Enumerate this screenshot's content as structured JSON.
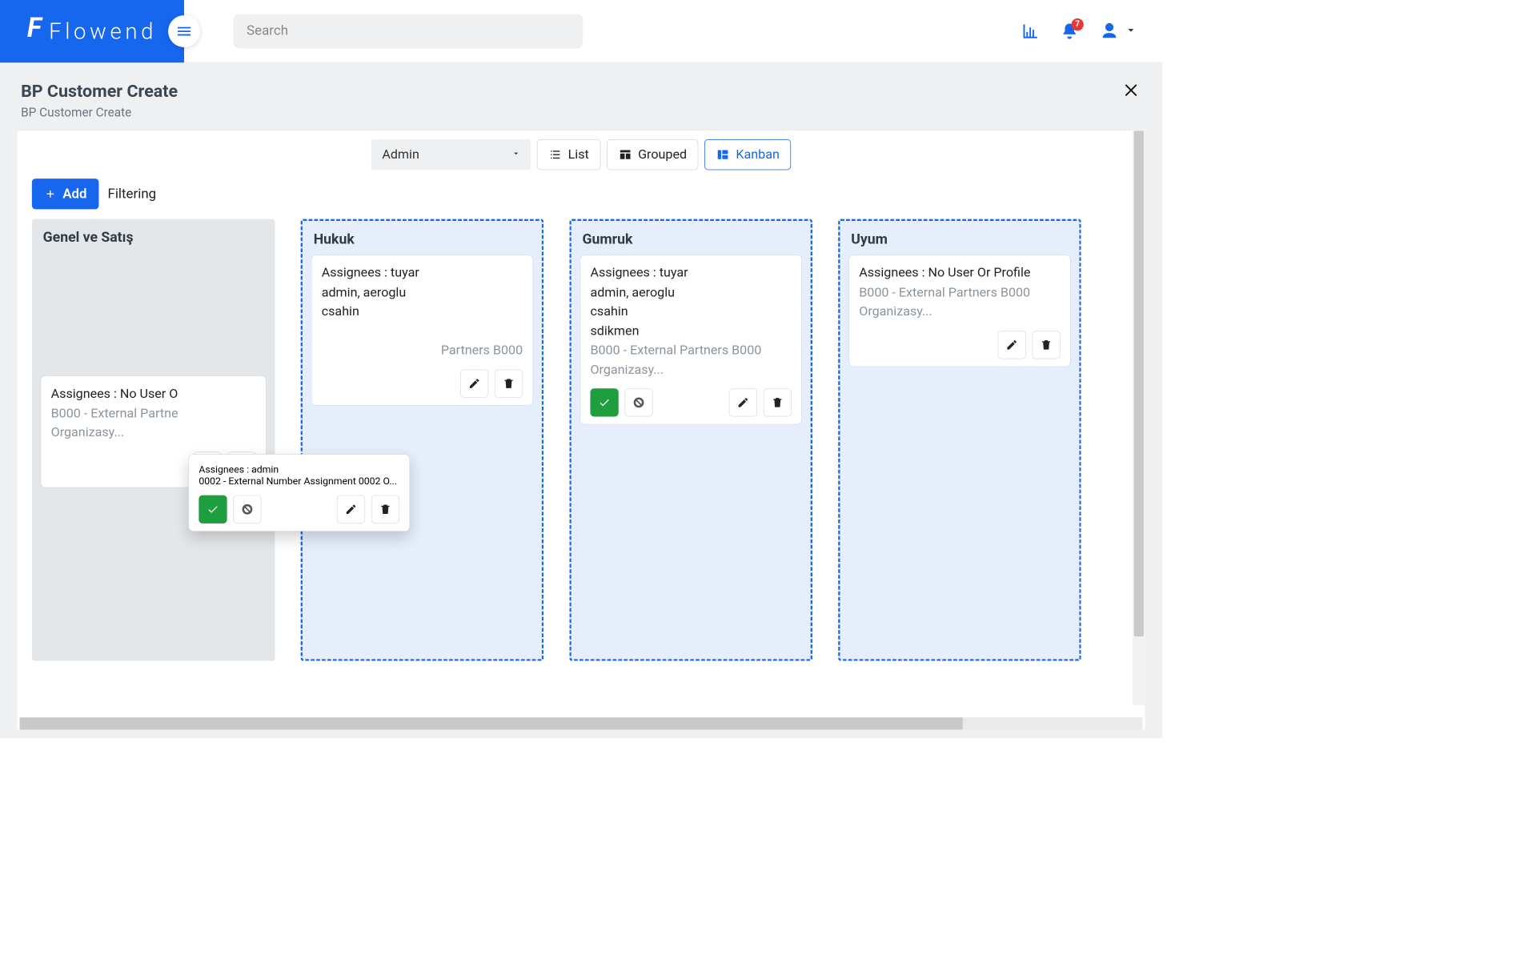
{
  "brand": {
    "name": "Flowend"
  },
  "search": {
    "placeholder": "Search"
  },
  "notifications": {
    "count": 7
  },
  "page": {
    "title": "BP Customer Create",
    "subtitle": "BP Customer Create"
  },
  "roleSelect": {
    "selected": "Admin"
  },
  "viewButtons": {
    "list": "List",
    "grouped": "Grouped",
    "kanban": "Kanban",
    "active": "kanban"
  },
  "toolbar": {
    "add": "Add",
    "filtering": "Filtering"
  },
  "columns": [
    {
      "key": "genel",
      "title": "Genel ve Satış",
      "style": "plain",
      "cards": [
        {
          "assignees_label": "Assignees : No User O",
          "desc": "B000 - External Partne",
          "desc2": "Organizasy...",
          "show_status": false
        }
      ]
    },
    {
      "key": "hukuk",
      "title": "Hukuk",
      "style": "dashed",
      "cards": [
        {
          "assignees_label": "Assignees : tuyar",
          "lines": [
            "admin, aeroglu",
            "csahin"
          ],
          "desc": "Partners B000",
          "show_status": false,
          "show_edit": true
        }
      ]
    },
    {
      "key": "gumruk",
      "title": "Gumruk",
      "style": "dashed",
      "cards": [
        {
          "assignees_label": "Assignees : tuyar",
          "lines": [
            "admin, aeroglu",
            "csahin",
            "sdikmen"
          ],
          "desc": "B000 - External Partners B000 Organizasy...",
          "show_status": true
        }
      ]
    },
    {
      "key": "uyum",
      "title": "Uyum",
      "style": "dashed",
      "cards": [
        {
          "assignees_label": "Assignees : No User Or Profile",
          "desc": "B000 - External Partners B000 Organizasy...",
          "show_status": false,
          "show_edit": true
        }
      ]
    }
  ],
  "drag_card": {
    "assignees_label": "Assignees : admin",
    "desc": "0002 - External Number Assignment 0002 O..."
  }
}
